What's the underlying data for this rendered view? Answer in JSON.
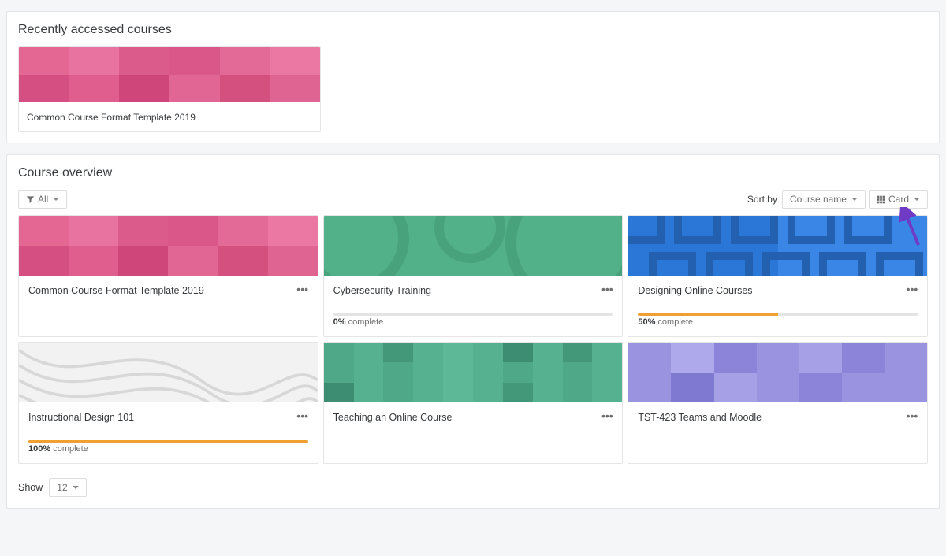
{
  "recent": {
    "heading": "Recently accessed courses",
    "items": [
      {
        "title": "Common Course Format Template 2019",
        "thumb": "pink"
      }
    ]
  },
  "overview": {
    "heading": "Course overview",
    "filter_label": "All",
    "sort_by_label": "Sort by",
    "sort_value": "Course name",
    "view_value": "Card",
    "show_label": "Show",
    "show_value": "12",
    "courses": [
      {
        "title": "Common Course Format Template 2019",
        "thumb": "pink",
        "progress_pct": null,
        "progress_text": null
      },
      {
        "title": "Cybersecurity Training",
        "thumb": "green-circles",
        "progress_pct": 0,
        "progress_text": "0% complete"
      },
      {
        "title": "Designing Online Courses",
        "thumb": "blue-squares",
        "progress_pct": 50,
        "progress_text": "50% complete"
      },
      {
        "title": "Instructional Design 101",
        "thumb": "gray-curves",
        "progress_pct": 100,
        "progress_text": "100% complete"
      },
      {
        "title": "Teaching an Online Course",
        "thumb": "green-tiles",
        "progress_pct": null,
        "progress_text": null
      },
      {
        "title": "TST-423 Teams and Moodle",
        "thumb": "purple-tiles",
        "progress_pct": null,
        "progress_text": null
      }
    ]
  }
}
